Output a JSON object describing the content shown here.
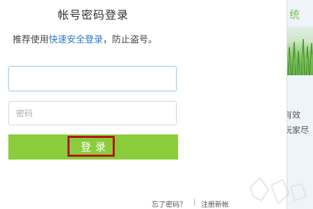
{
  "login": {
    "title": "帐号密码登录",
    "subtitle_prefix": "推荐使用",
    "subtitle_link": "快速安全登录",
    "subtitle_suffix": "，防止盗号。",
    "account_value": "",
    "password_placeholder": "密码",
    "login_button": "登录"
  },
  "footer": {
    "forgot_password": "忘了密码？",
    "separator": "|",
    "register": "注册新帐"
  },
  "side_panel": {
    "title": "统",
    "line1": "有效",
    "line2": "玩家尽"
  },
  "colors": {
    "button_green": "#8bcc3c",
    "highlight_red": "#b4151b",
    "link_blue": "#2a78c8"
  }
}
